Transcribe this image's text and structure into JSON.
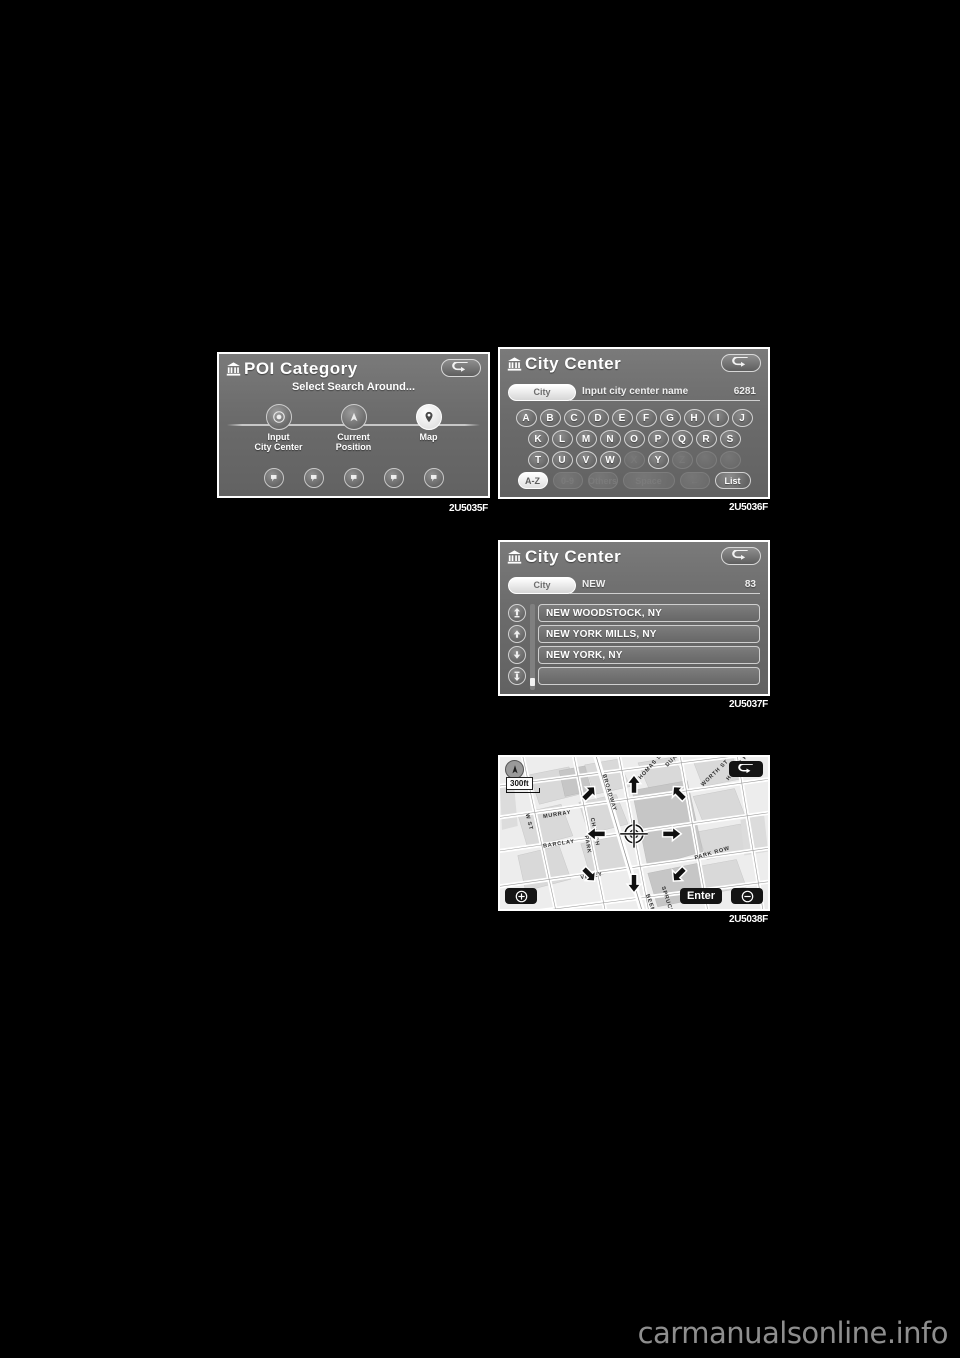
{
  "page": {
    "background": "#000000",
    "watermark": "carmanualsonline.info"
  },
  "figures": [
    {
      "id": "poi-category",
      "caption": "2U5035F",
      "title": "POI Category",
      "title_icon": "bank-building-icon",
      "subtitle": "Select Search Around...",
      "back_icon": "back-arrow-icon",
      "tabs": [
        {
          "label": "Input\nCity Center",
          "icon": "target-circle-icon",
          "active": false
        },
        {
          "label": "Current\nPosition",
          "icon": "car-position-icon",
          "active": false
        },
        {
          "label": "Map",
          "icon": "map-pin-icon",
          "active": true
        }
      ],
      "bottom_buttons": [
        {
          "icon": "poi-marker-icon-1"
        },
        {
          "icon": "poi-marker-icon-2"
        },
        {
          "icon": "poi-marker-icon-3"
        },
        {
          "icon": "poi-marker-icon-4"
        },
        {
          "icon": "poi-marker-icon-5"
        }
      ]
    },
    {
      "id": "city-center-keyboard",
      "caption": "2U5036F",
      "title": "City  Center",
      "title_icon": "bank-building-icon",
      "back_icon": "back-arrow-icon",
      "tag_label": "City",
      "input_value": "Input city center name",
      "match_count": "6281",
      "keyboard": {
        "row1": [
          "A",
          "B",
          "C",
          "D",
          "E",
          "F",
          "G",
          "H",
          "I",
          "J"
        ],
        "row2": [
          "K",
          "L",
          "M",
          "N",
          "O",
          "P",
          "Q",
          "R",
          "S"
        ],
        "row3": [
          "T",
          "U",
          "V",
          "W",
          "X",
          "Y",
          "Z"
        ],
        "row3_disabled": [
          "X",
          "Z"
        ],
        "row3_blanks": 2,
        "function_keys": [
          {
            "label": "A-Z",
            "state": "highlighted"
          },
          {
            "label": "0-9",
            "state": "disabled"
          },
          {
            "label": "Others",
            "state": "disabled"
          },
          {
            "label": "Space",
            "state": "disabled"
          },
          {
            "label": "←",
            "state": "disabled"
          },
          {
            "label": "List",
            "state": "normal"
          }
        ]
      }
    },
    {
      "id": "city-center-results",
      "caption": "2U5037F",
      "title": "City  Center",
      "title_icon": "bank-building-icon",
      "back_icon": "back-arrow-icon",
      "tag_label": "City",
      "input_value": "NEW",
      "match_count": "83",
      "scroll_buttons": [
        "page-up-icon",
        "scroll-up-icon",
        "scroll-down-icon",
        "page-down-icon"
      ],
      "results": [
        "NEW WOODSTOCK, NY",
        "NEW YORK MILLS, NY",
        "NEW YORK, NY",
        ""
      ]
    },
    {
      "id": "map-select",
      "caption": "2U5038F",
      "back_icon": "back-arrow-icon",
      "scale_label": "300ft",
      "north_icon": "north-up-icon",
      "cursor_icon": "crosshair-cursor-icon",
      "zoom_in_label": "zoom-in-icon",
      "zoom_out_label": "zoom-out-icon",
      "enter_label": "Enter",
      "direction_arrows": [
        "arrow-up",
        "arrow-up-left",
        "arrow-up-right",
        "arrow-left",
        "arrow-right",
        "arrow-down-left",
        "arrow-down-right",
        "arrow-down"
      ],
      "street_labels": [
        "MURRAY",
        "BARCLAY",
        "VESEY",
        "PARK PL",
        "BROADWAY",
        "CHURCH ST",
        "THOMAS ST",
        "WORTH ST",
        "HOGAN PL",
        "PARK ROW",
        "SPRUCE",
        "BEEKMAN",
        "W ST",
        "DUANE ST"
      ]
    }
  ]
}
